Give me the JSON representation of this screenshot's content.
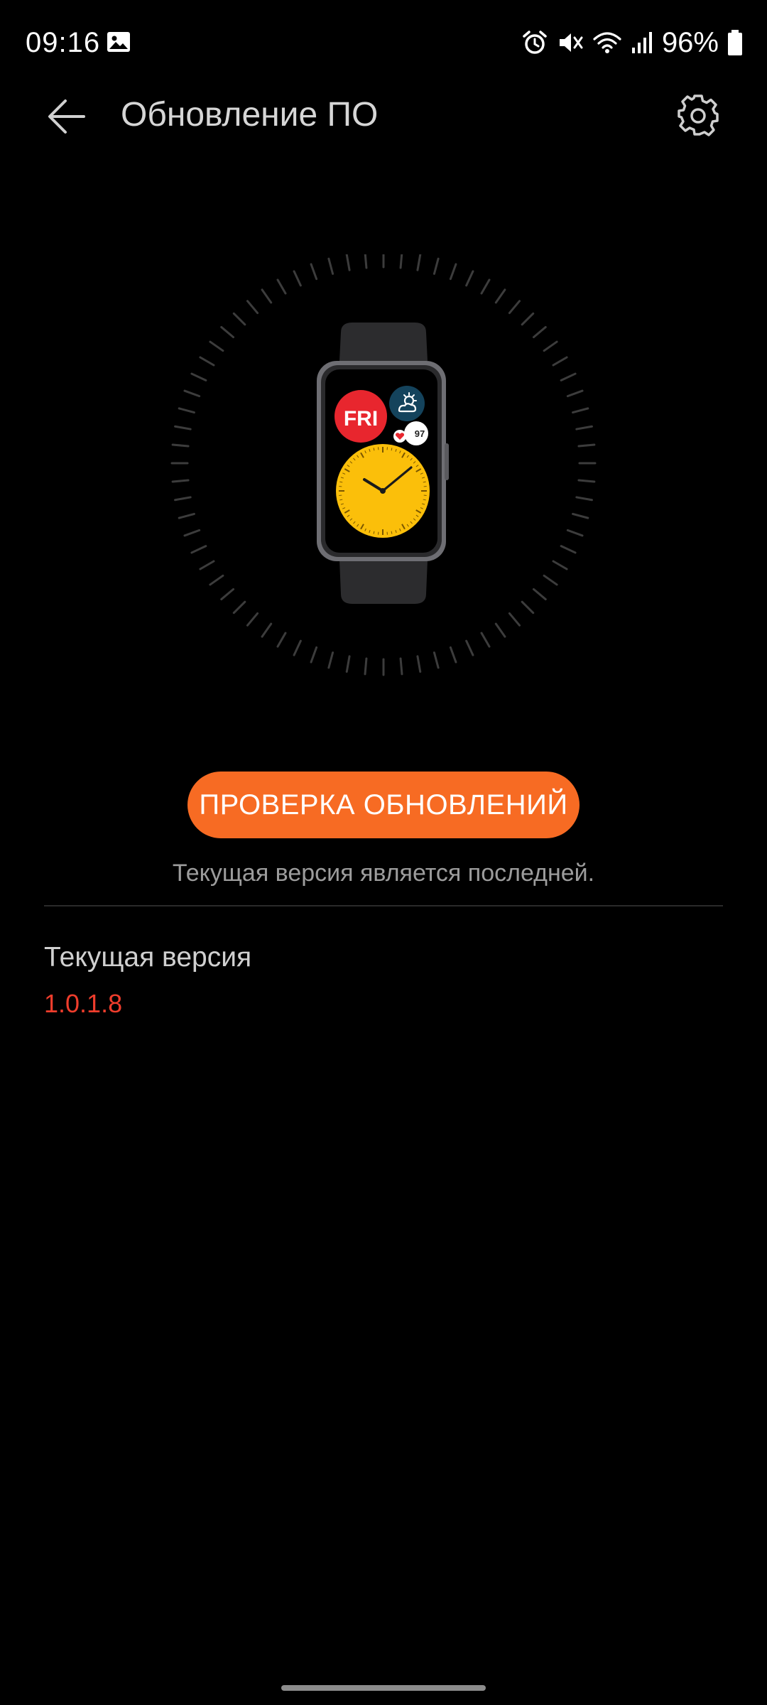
{
  "status_bar": {
    "time": "09:16",
    "battery_percent": "96%",
    "icons": [
      "gallery-icon",
      "alarm-icon",
      "mute-icon",
      "wifi-icon",
      "signal-icon",
      "battery-icon"
    ]
  },
  "app_bar": {
    "title": "Обновление ПО",
    "back_icon": "arrow-left-icon",
    "settings_icon": "gear-icon"
  },
  "device": {
    "watch_face_day": "FRI",
    "heart_rate": "97"
  },
  "update": {
    "button_label": "ПРОВЕРКА ОБНОВЛЕНИЙ",
    "status_message": "Текущая версия является последней."
  },
  "version": {
    "label": "Текущая версия",
    "value": "1.0.1.8"
  },
  "colors": {
    "accent_orange": "#f76b23",
    "version_red": "#ef3d2c",
    "background": "#000000",
    "watch_face_yellow": "#fbbf0a",
    "watch_date_red": "#e8262e"
  }
}
